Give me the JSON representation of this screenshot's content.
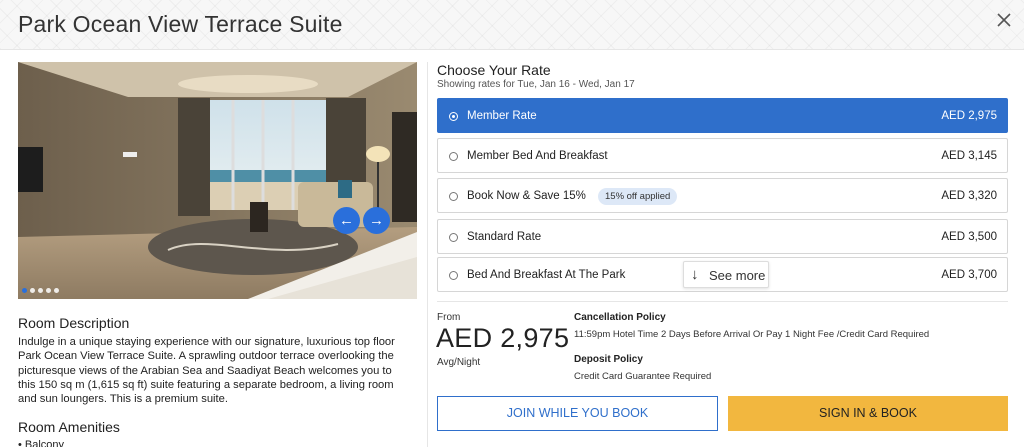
{
  "header": {
    "title": "Park Ocean View Terrace Suite"
  },
  "gallery": {
    "slide_count": 5,
    "active_slide": 1,
    "prev_icon": "←",
    "next_icon": "→"
  },
  "room": {
    "description_title": "Room Description",
    "description": "Indulge in a unique staying experience with our signature, luxurious top floor Park Ocean View Terrace Suite. A sprawling outdoor terrace overlooking the picturesque views of the Arabian Sea and Saadiyat Beach welcomes you to this 150 sq m (1,615 sq ft) suite featuring a separate bedroom, a living room and sun loungers. This is a premium suite.",
    "amenities_title": "Room Amenities",
    "amenities_first": "• Balcony"
  },
  "rates": {
    "title": "Choose Your Rate",
    "subtitle": "Showing rates for Tue, Jan 16 - Wed, Jan 17",
    "items": [
      {
        "name": "Member Rate",
        "price": "AED 2,975",
        "selected": true
      },
      {
        "name": "Member Bed And Breakfast",
        "price": "AED 3,145"
      },
      {
        "name": "Book Now & Save 15%",
        "price": "AED 3,320",
        "badge": "15% off applied"
      },
      {
        "name": "Standard Rate",
        "price": "AED 3,500"
      },
      {
        "name": "Bed And Breakfast At The Park",
        "price": "AED 3,700"
      }
    ],
    "see_more": "See more",
    "see_more_icon": "↓"
  },
  "summary": {
    "from_label": "From",
    "amount": "AED 2,975",
    "unit": "Avg/Night",
    "cancellation_title": "Cancellation Policy",
    "cancellation_text": "11:59pm Hotel Time 2 Days Before Arrival Or Pay 1 Night Fee /Credit Card Required",
    "deposit_title": "Deposit Policy",
    "deposit_text": "Credit Card Guarantee Required"
  },
  "actions": {
    "join": "JOIN WHILE YOU BOOK",
    "sign_in": "SIGN IN & BOOK"
  },
  "colors": {
    "accent": "#2f6fcb",
    "cta": "#f2b73f"
  }
}
